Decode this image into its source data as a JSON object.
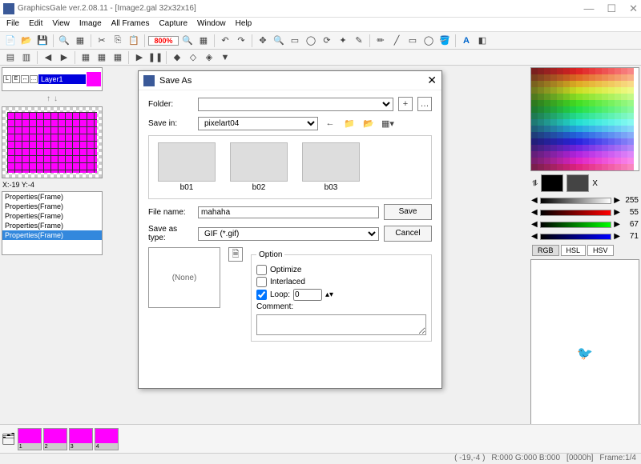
{
  "window": {
    "title": "GraphicsGale ver.2.08.11 - [Image2.gal 32x32x16]"
  },
  "menu": [
    "File",
    "Edit",
    "View",
    "Image",
    "All Frames",
    "Capture",
    "Window",
    "Help"
  ],
  "zoom": "800%",
  "layer": {
    "name": "Layer1"
  },
  "coords": "X:-19 Y:-4",
  "props": [
    "Properties(Frame)",
    "Properties(Frame)",
    "Properties(Frame)",
    "Properties(Frame)",
    "Properties(Frame)"
  ],
  "sliders": {
    "gray": "255",
    "r": "55",
    "g": "67",
    "b": "71"
  },
  "modes": [
    "RGB",
    "HSL",
    "HSV"
  ],
  "dialog": {
    "title": "Save As",
    "folder_label": "Folder:",
    "savein_label": "Save in:",
    "savein": "pixelart04",
    "files": [
      "b01",
      "b02",
      "b03"
    ],
    "filename_label": "File name:",
    "filename": "mahaha",
    "saveas_label": "Save as type:",
    "saveas": "GIF (*.gif)",
    "save": "Save",
    "cancel": "Cancel",
    "none": "(None)",
    "option": "Option",
    "optimize": "Optimize",
    "interlaced": "Interlaced",
    "loop": "Loop:",
    "loopval": "0",
    "comment": "Comment:"
  },
  "frames": [
    "1",
    "2",
    "3",
    "4"
  ],
  "status": {
    "pos": "( -19,-4 )",
    "rgb": "R:000 G:000 B:000",
    "hex": "[0000h]",
    "frame": "Frame:1/4"
  }
}
